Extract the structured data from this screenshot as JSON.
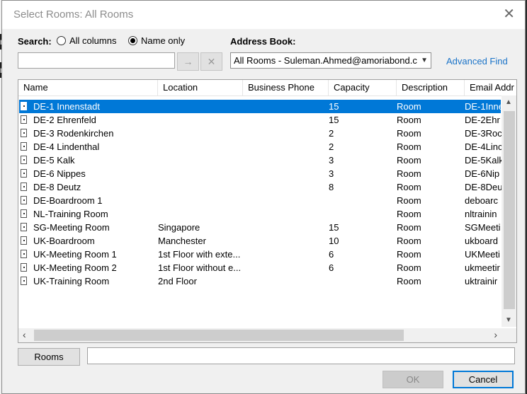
{
  "background": {
    "fragment_1": "nu",
    "fragment_2": "nu"
  },
  "dialog": {
    "title": "Select Rooms: All Rooms",
    "close_symbol": "✕"
  },
  "search": {
    "label": "Search:",
    "option_all": "All columns",
    "option_name": "Name only",
    "selected": "Name only",
    "value": "",
    "go_symbol": "→",
    "clear_symbol": "✕"
  },
  "address_book": {
    "label": "Address Book:",
    "selected": "All Rooms - Suleman.Ahmed@amoriabond.c",
    "advanced_find": "Advanced Find"
  },
  "table": {
    "columns": [
      "Name",
      "Location",
      "Business Phone",
      "Capacity",
      "Description",
      "Email Addr"
    ],
    "rows": [
      {
        "name": "DE-1 Innenstadt",
        "location": "",
        "phone": "",
        "capacity": "15",
        "description": "Room",
        "email": "DE-1Inne",
        "selected": true
      },
      {
        "name": "DE-2 Ehrenfeld",
        "location": "",
        "phone": "",
        "capacity": "15",
        "description": "Room",
        "email": "DE-2Ehr"
      },
      {
        "name": "DE-3 Rodenkirchen",
        "location": "",
        "phone": "",
        "capacity": "2",
        "description": "Room",
        "email": "DE-3Roc"
      },
      {
        "name": "DE-4 Lindenthal",
        "location": "",
        "phone": "",
        "capacity": "2",
        "description": "Room",
        "email": "DE-4Linc"
      },
      {
        "name": "DE-5 Kalk",
        "location": "",
        "phone": "",
        "capacity": "3",
        "description": "Room",
        "email": "DE-5Kalk"
      },
      {
        "name": "DE-6 Nippes",
        "location": "",
        "phone": "",
        "capacity": "3",
        "description": "Room",
        "email": "DE-6Nip"
      },
      {
        "name": "DE-8 Deutz",
        "location": "",
        "phone": "",
        "capacity": "8",
        "description": "Room",
        "email": "DE-8Deu"
      },
      {
        "name": "DE-Boardroom 1",
        "location": "",
        "phone": "",
        "capacity": "",
        "description": "Room",
        "email": "deboarc"
      },
      {
        "name": "NL-Training Room",
        "location": "",
        "phone": "",
        "capacity": "",
        "description": "Room",
        "email": "nltrainin"
      },
      {
        "name": "SG-Meeting Room",
        "location": "Singapore",
        "phone": "",
        "capacity": "15",
        "description": "Room",
        "email": "SGMeeti"
      },
      {
        "name": "UK-Boardroom",
        "location": "Manchester",
        "phone": "",
        "capacity": "10",
        "description": "Room",
        "email": "ukboard"
      },
      {
        "name": "UK-Meeting Room 1",
        "location": "1st Floor with exte...",
        "phone": "",
        "capacity": "6",
        "description": "Room",
        "email": "UKMeeti"
      },
      {
        "name": "UK-Meeting Room 2",
        "location": "1st Floor without e...",
        "phone": "",
        "capacity": "6",
        "description": "Room",
        "email": "ukmeetir"
      },
      {
        "name": "UK-Training Room",
        "location": "2nd Floor",
        "phone": "",
        "capacity": "",
        "description": "Room",
        "email": "uktrainir"
      }
    ]
  },
  "footer": {
    "rooms_button": "Rooms",
    "rooms_value": "",
    "ok": "OK",
    "cancel": "Cancel"
  },
  "colors": {
    "selection": "#0078d7",
    "link": "#1a73c8"
  },
  "icons": {
    "row_icon": "room-icon",
    "close": "close-icon",
    "go": "arrow-right-icon",
    "clear": "clear-icon",
    "dropdown": "chevron-down-icon"
  }
}
